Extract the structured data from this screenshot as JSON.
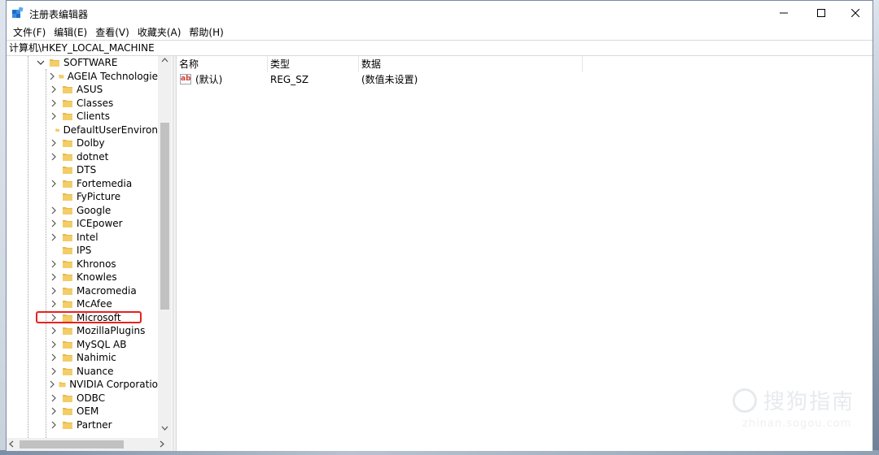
{
  "window": {
    "title": "注册表编辑器"
  },
  "menu": [
    "文件(F)",
    "编辑(E)",
    "查看(V)",
    "收藏夹(A)",
    "帮助(H)"
  ],
  "address": "计算机\\HKEY_LOCAL_MACHINE",
  "tree": {
    "root": "SOFTWARE",
    "items": [
      {
        "label": "AGEIA Technologie",
        "expandable": true
      },
      {
        "label": "ASUS",
        "expandable": true
      },
      {
        "label": "Classes",
        "expandable": true
      },
      {
        "label": "Clients",
        "expandable": true
      },
      {
        "label": "DefaultUserEnviron",
        "expandable": false
      },
      {
        "label": "Dolby",
        "expandable": true
      },
      {
        "label": "dotnet",
        "expandable": true
      },
      {
        "label": "DTS",
        "expandable": false
      },
      {
        "label": "Fortemedia",
        "expandable": true
      },
      {
        "label": "FyPicture",
        "expandable": false
      },
      {
        "label": "Google",
        "expandable": true
      },
      {
        "label": "ICEpower",
        "expandable": true
      },
      {
        "label": "Intel",
        "expandable": true
      },
      {
        "label": "IPS",
        "expandable": false
      },
      {
        "label": "Khronos",
        "expandable": true
      },
      {
        "label": "Knowles",
        "expandable": true
      },
      {
        "label": "Macromedia",
        "expandable": true
      },
      {
        "label": "McAfee",
        "expandable": true
      },
      {
        "label": "Microsoft",
        "expandable": true,
        "highlighted": true
      },
      {
        "label": "MozillaPlugins",
        "expandable": true
      },
      {
        "label": "MySQL AB",
        "expandable": true
      },
      {
        "label": "Nahimic",
        "expandable": true
      },
      {
        "label": "Nuance",
        "expandable": true
      },
      {
        "label": "NVIDIA Corporatio",
        "expandable": true
      },
      {
        "label": "ODBC",
        "expandable": true
      },
      {
        "label": "OEM",
        "expandable": true
      },
      {
        "label": "Partner",
        "expandable": true
      }
    ]
  },
  "values": {
    "columns": [
      "名称",
      "类型",
      "数据"
    ],
    "rows": [
      {
        "name": "(默认)",
        "type": "REG_SZ",
        "data": "(数值未设置)"
      }
    ]
  },
  "watermark": {
    "main": "搜狗指南",
    "sub": "zhinan.sogou.com"
  },
  "colors": {
    "folder": "#e8b84a",
    "highlight_box": "#e8211f",
    "scrollbar_thumb": "#c1c1c1"
  }
}
